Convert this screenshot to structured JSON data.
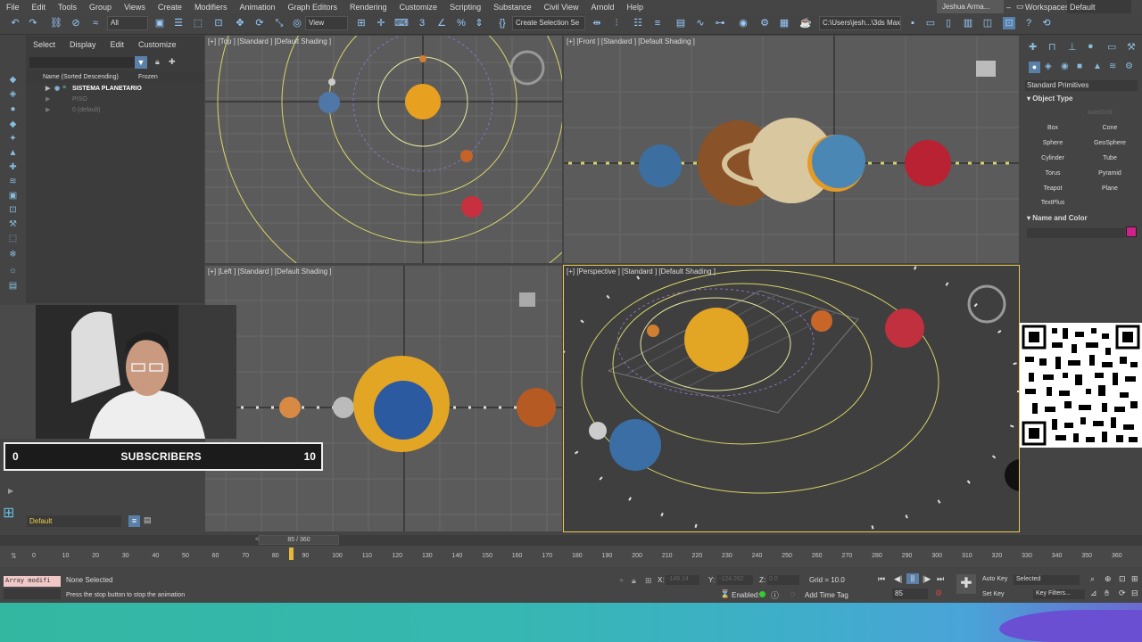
{
  "menu": [
    "File",
    "Edit",
    "Tools",
    "Group",
    "Views",
    "Create",
    "Modifiers",
    "Animation",
    "Graph Editors",
    "Rendering",
    "Customize",
    "Scripting",
    "Substance",
    "Civil View",
    "Arnold",
    "Help"
  ],
  "user": "Jeshua Arma...",
  "workspaces_label": "Workspaces:",
  "workspace_value": "Default",
  "toolbar": {
    "selection_filter": "All",
    "view_dropdown": "View",
    "create_selection_set": "Create Selection Se",
    "path": "C:\\Users\\jesh...\\3ds Max 202"
  },
  "scene_explorer": {
    "tabs": [
      "Select",
      "Display",
      "Edit",
      "Customize"
    ],
    "column_name": "Name (Sorted Descending)",
    "column_frozen": "Frozen",
    "rows": [
      "SISTEMA PLANETARIO",
      "PISO",
      "0 (default)"
    ]
  },
  "viewports": {
    "top": "[+] [Top ] [Standard ] [Default Shading ]",
    "front": "[+] [Front ] [Standard ] [Default Shading ]",
    "left": "[+] [Left ] [Standard ] [Default Shading ]",
    "perspective": "[+] [Perspective ] [Standard ] [Default Shading ]"
  },
  "command_panel": {
    "category": "Standard Primitives",
    "object_type_title": "Object Type",
    "autogrid": "AutoGrid",
    "buttons": [
      "Box",
      "Cone",
      "Sphere",
      "GeoSphere",
      "Cylinder",
      "Tube",
      "Torus",
      "Pyramid",
      "Teapot",
      "Plane",
      "TextPlus"
    ],
    "name_color_title": "Name and Color",
    "swatch_color": "#d0208a"
  },
  "overlay": {
    "subscribers_left": "0",
    "subscribers_label": "SUBSCRIBERS",
    "subscribers_right": "10"
  },
  "layers": {
    "default_label": "Default"
  },
  "timeline": {
    "slider_label": "85 / 360",
    "current_frame": 85,
    "total_frames": 360,
    "ticks": [
      "0",
      "10",
      "20",
      "30",
      "40",
      "50",
      "60",
      "70",
      "80",
      "90",
      "100",
      "110",
      "120",
      "130",
      "140",
      "150",
      "160",
      "170",
      "180",
      "190",
      "200",
      "210",
      "220",
      "230",
      "240",
      "250",
      "260",
      "270",
      "280",
      "290",
      "300",
      "310",
      "320",
      "330",
      "340",
      "350",
      "360"
    ]
  },
  "status": {
    "maxscript": "Array modifi",
    "selection": "None Selected",
    "prompt": "Press the stop button to stop the animation",
    "x_label": "X:",
    "x_value": "-149.14",
    "y_label": "Y:",
    "y_value": "-124.262",
    "z_label": "Z:",
    "z_value": "0.0",
    "grid": "Grid = 10.0",
    "enabled": "Enabled:",
    "add_time_tag": "Add Time Tag",
    "auto_key": "Auto Key",
    "selected": "Selected",
    "set_key": "Set Key",
    "key_filters": "Key Filters...",
    "frame_field": "85"
  }
}
